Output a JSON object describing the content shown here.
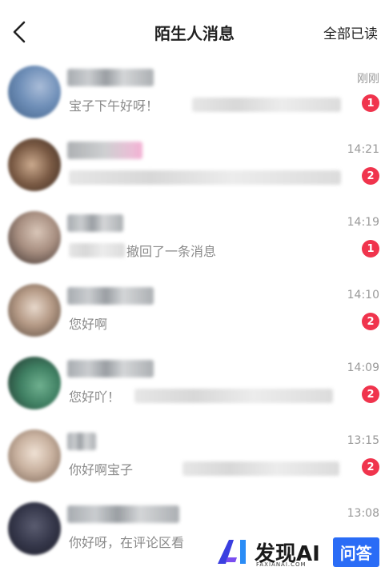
{
  "header": {
    "title": "陌生人消息",
    "mark_all_read": "全部已读",
    "back_icon": "chevron-left-icon"
  },
  "conversations": [
    {
      "time": "刚刚",
      "preview": "宝子下午好呀！",
      "unread": "1"
    },
    {
      "time": "14:21",
      "preview": "",
      "unread": "2"
    },
    {
      "time": "14:19",
      "preview": "撤回了一条消息",
      "unread": "1"
    },
    {
      "time": "14:10",
      "preview": "您好啊",
      "unread": "2"
    },
    {
      "time": "14:09",
      "preview": "您好吖！",
      "unread": "2"
    },
    {
      "time": "13:15",
      "preview": "你好啊宝子",
      "unread": "2"
    },
    {
      "time": "13:08",
      "preview": "你好呀，在评论区看",
      "unread": ""
    }
  ],
  "watermark": {
    "brand": "发现AI",
    "domain": "FAXIANAI.COM",
    "tag": "问答"
  },
  "colors": {
    "badge": "#f0344d",
    "watermark_tag": "#2a6cf6"
  }
}
